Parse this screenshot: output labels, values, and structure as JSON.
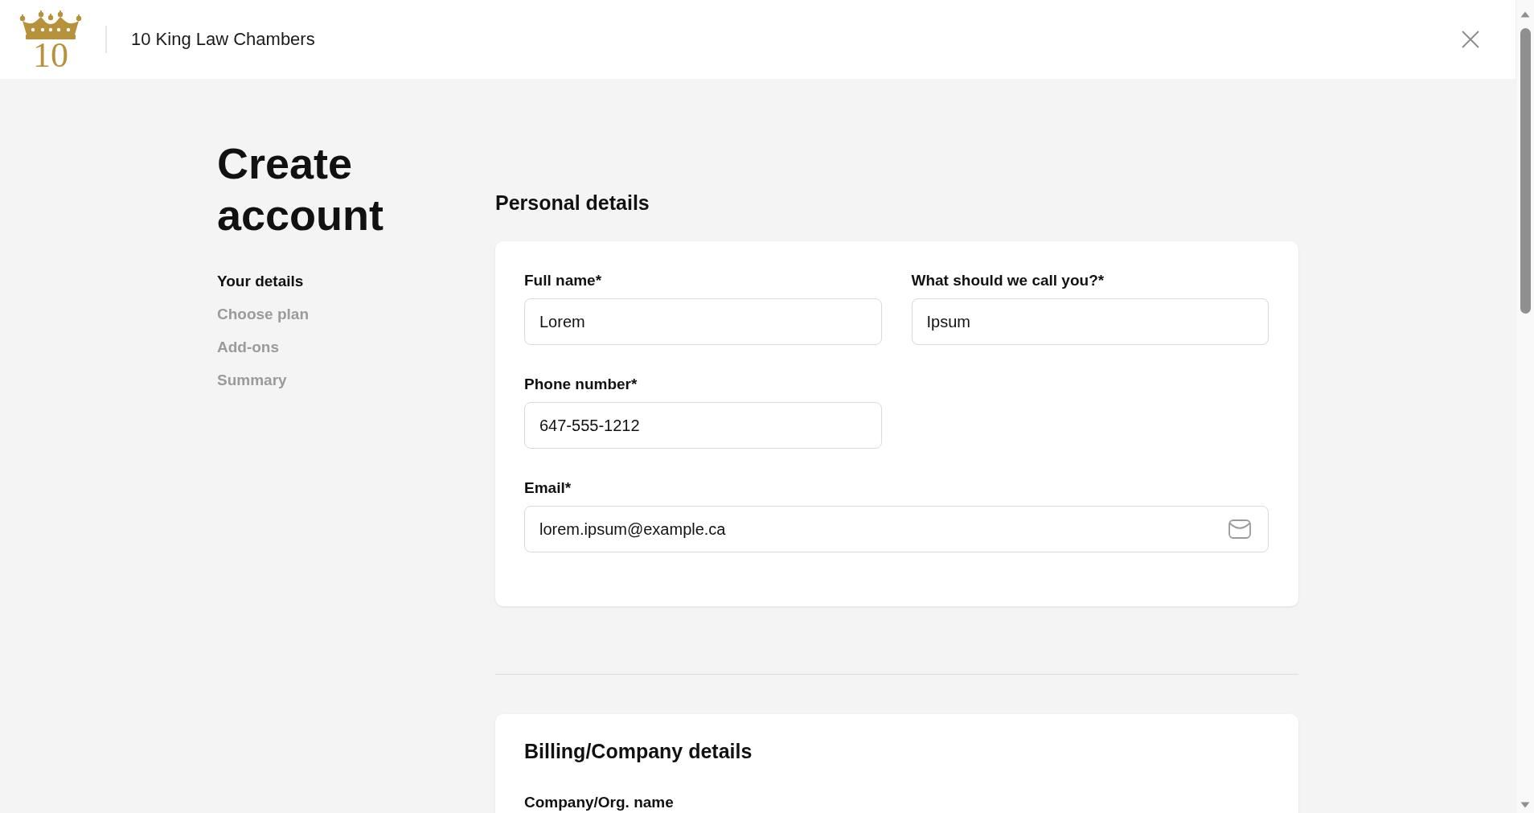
{
  "header": {
    "logo_text": "10",
    "title": "10 King Law Chambers"
  },
  "page_title": "Create account",
  "steps": [
    {
      "label": "Your details",
      "selected": true
    },
    {
      "label": "Choose plan",
      "selected": false
    },
    {
      "label": "Add-ons",
      "selected": false
    },
    {
      "label": "Summary",
      "selected": false
    }
  ],
  "personal_details": {
    "title": "Personal details",
    "fields": [
      {
        "kind": "text",
        "label": "Full name*",
        "value": "Lorem"
      },
      {
        "kind": "text",
        "label": "What should we call you?*",
        "value": "Ipsum"
      },
      {
        "kind": "phone",
        "label": "Phone number*",
        "value": "647-555-1212"
      },
      {
        "kind": "email",
        "label": "Email*",
        "value": "lorem.ipsum@example.ca"
      }
    ]
  },
  "billing_details": {
    "title": "Billing/Company details",
    "fields": [
      {
        "label": "Company/Org. name"
      }
    ]
  }
}
